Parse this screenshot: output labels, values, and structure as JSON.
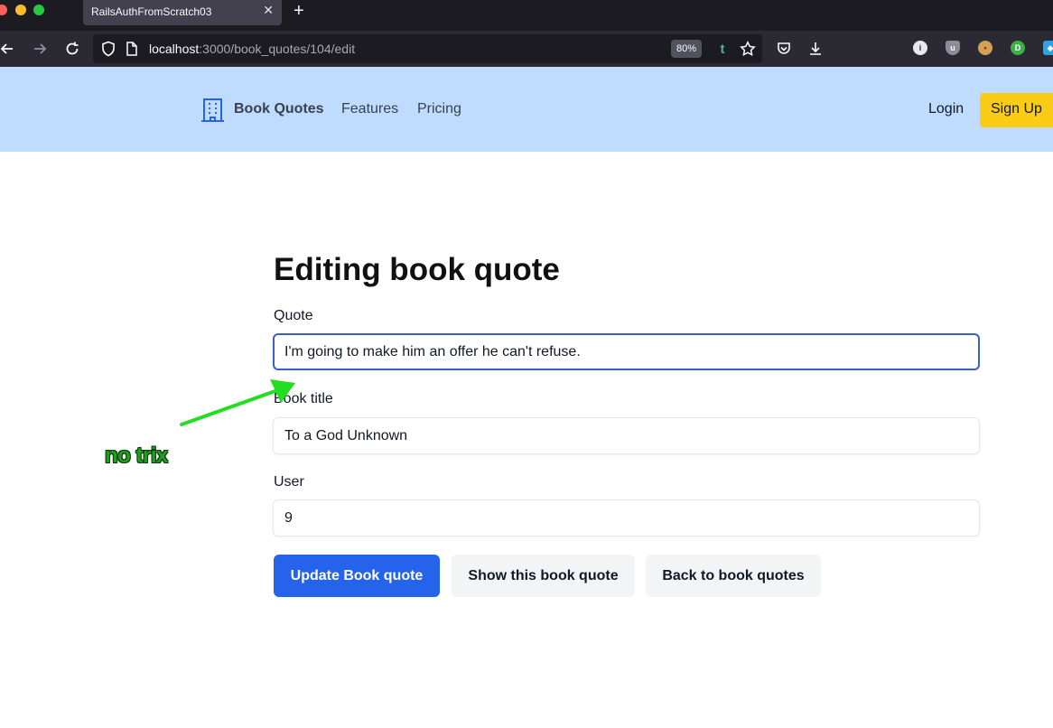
{
  "browser": {
    "tab_title": "RailsAuthFromScratch03",
    "tab_close": "✕",
    "new_tab": "+",
    "url_host": "localhost",
    "url_rest": ":3000/book_quotes/104/edit",
    "zoom": "80%",
    "tumblr_letter": "t"
  },
  "site": {
    "brand": "Book Quotes",
    "nav": [
      "Features",
      "Pricing"
    ],
    "login": "Login",
    "signup": "Sign Up",
    "colors": {
      "header_bg": "#bfdbfe",
      "signup_bg": "#facc15",
      "primary": "#2563eb"
    }
  },
  "form": {
    "title": "Editing book quote",
    "quote_label": "Quote",
    "quote_value": "I'm going to make him an offer he can't refuse.",
    "book_title_label": "Book title",
    "book_title_value": "To a God Unknown",
    "user_label": "User",
    "user_value": "9",
    "update_button": "Update Book quote",
    "show_button": "Show this book quote",
    "back_button": "Back to book quotes"
  },
  "annotation": {
    "text": "no trix",
    "color": "#1f9e1f"
  }
}
